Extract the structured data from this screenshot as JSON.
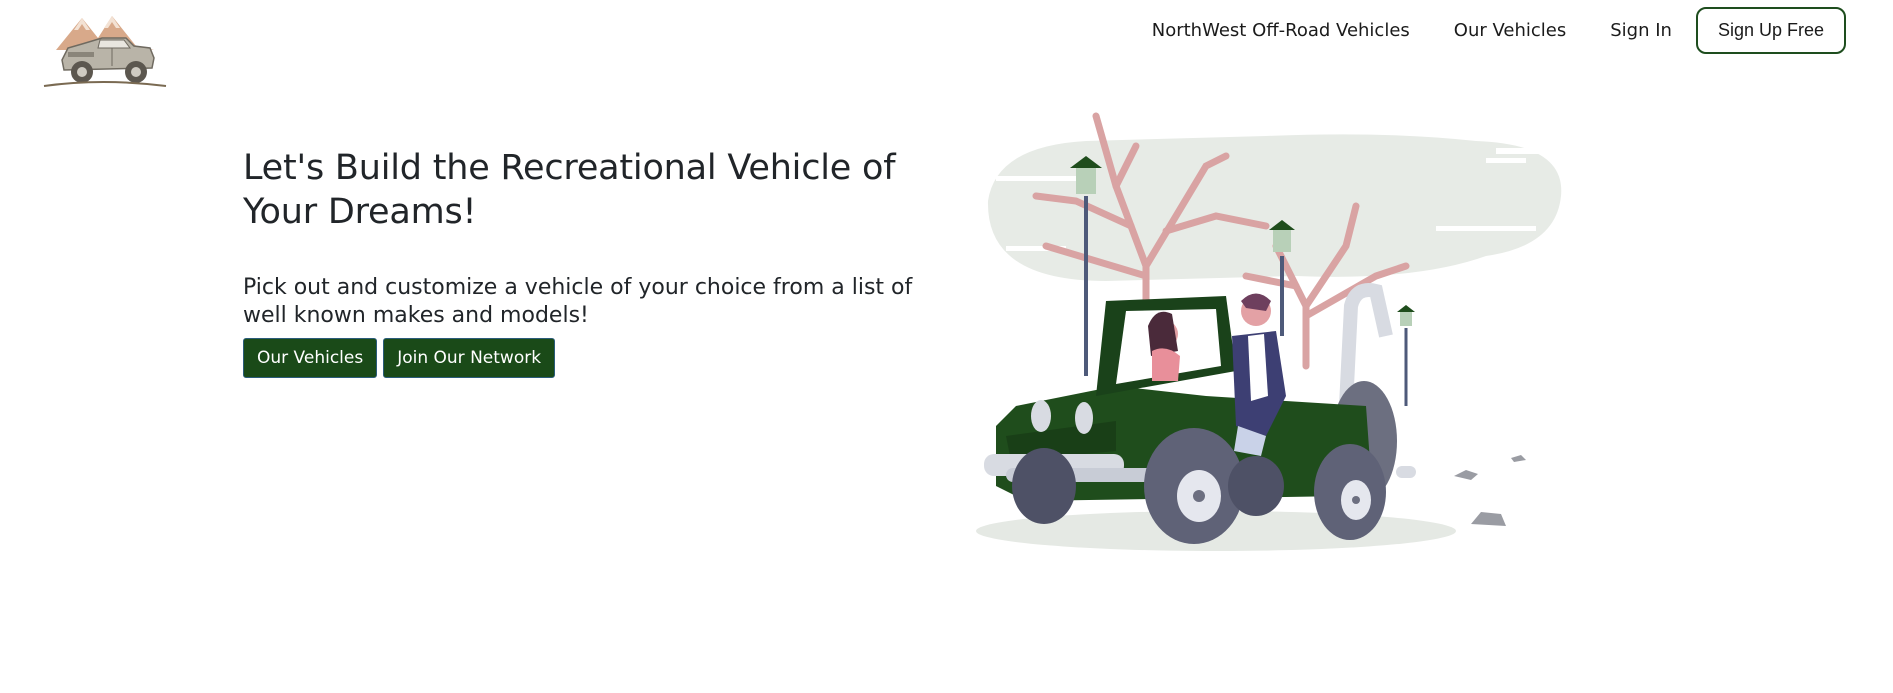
{
  "header": {
    "logo_icon": "offroad-truck-mountain-logo",
    "nav": {
      "brand_link": "NorthWest Off-Road Vehicles",
      "vehicles_link": "Our Vehicles",
      "signin_link": "Sign In",
      "signup_button": "Sign Up Free"
    }
  },
  "hero": {
    "title": "Let's Build the Recreational Vehicle of Your Dreams!",
    "subtitle": "Pick out and customize a vehicle of your choice from a list of well known makes and models!",
    "buttons": {
      "vehicles": "Our Vehicles",
      "network": "Join Our Network"
    },
    "illustration_icon": "jeep-couple-illustration"
  },
  "colors": {
    "brand_green": "#1a4a18",
    "jeep_green": "#1f4d1c",
    "tree_pink": "#d9a3a3",
    "backdrop_gray": "#e6ebe6"
  }
}
